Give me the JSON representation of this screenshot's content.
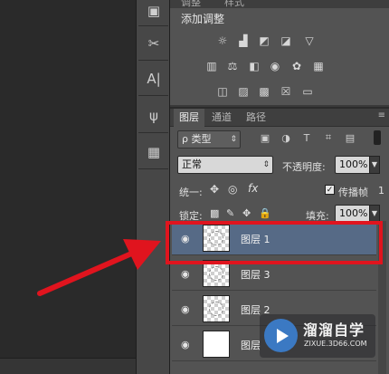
{
  "adjustments": {
    "tabs": [
      "调整",
      "样式"
    ],
    "title": "添加调整",
    "row1": [
      "brightness-icon",
      "levels-icon",
      "curves-icon",
      "exposure-icon",
      "vibrance-icon"
    ],
    "row2": [
      "hue-saturation-icon",
      "color-balance-icon",
      "black-white-icon",
      "photo-filter-icon",
      "channel-mixer-icon",
      "color-lookup-icon"
    ],
    "row3": [
      "invert-icon",
      "posterize-icon",
      "threshold-icon",
      "selective-color-icon",
      "gradient-map-icon"
    ]
  },
  "layers_panel": {
    "tabs": [
      "图层",
      "通道",
      "路径"
    ],
    "filter_label": "ρ 类型",
    "blend_mode": "正常",
    "opacity_label": "不透明度:",
    "opacity_value": "100%",
    "unify_label": "统一:",
    "propagate_label": "传播帧",
    "propagate_value": "1",
    "lock_label": "锁定:",
    "fill_label": "填充:",
    "fill_value": "100%",
    "layers": [
      {
        "name": "图层 1",
        "selected": true
      },
      {
        "name": "图层 3",
        "selected": false
      },
      {
        "name": "图层 2",
        "selected": false
      },
      {
        "name": "图层",
        "selected": false
      }
    ]
  },
  "watermark": {
    "title": "溜溜自学",
    "url": "ZIXUE.3D66.COM"
  },
  "colors": {
    "highlight": "#e0141e",
    "selected_row": "#566a86",
    "panel_bg": "#535353"
  }
}
